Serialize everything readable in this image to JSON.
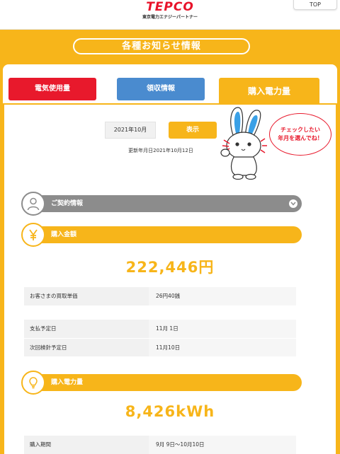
{
  "header": {
    "logo_text": "TEPCO",
    "logo_sub": "東京電力エナジーパートナー",
    "top_button": "TOP"
  },
  "section_title": "各種お知らせ情報",
  "tabs": [
    {
      "label": "電気使用量",
      "color": "#e8192c"
    },
    {
      "label": "領収情報",
      "color": "#4a8bcf"
    },
    {
      "label": "購入電力量",
      "color": "#f7b51a",
      "active": true
    }
  ],
  "selector": {
    "month_value": "2021年10月",
    "show_button": "表示",
    "updated_text": "更新年月日2021年10月12日"
  },
  "mascot": {
    "bubble_line1": "チェックしたい",
    "bubble_line2": "年月を選んでね！"
  },
  "contract": {
    "label": "ご契約情報"
  },
  "purchase_amount": {
    "label": "購入金額",
    "amount": "222,446円",
    "rows": [
      {
        "label": "お客さまの買取単価",
        "value": "26円40銭"
      }
    ],
    "rows2": [
      {
        "label": "支払予定日",
        "value": "11月 1日"
      },
      {
        "label": "次回検針予定日",
        "value": "11月10日"
      }
    ]
  },
  "purchase_power": {
    "label": "購入電力量",
    "amount": "8,426kWh",
    "rows": [
      {
        "label": "購入期間",
        "value": "9月 9日〜10月10日"
      }
    ]
  },
  "colors": {
    "accent": "#f7b51a",
    "red": "#e8192c",
    "blue": "#4a8bcf",
    "gray": "#8c8c8c"
  }
}
